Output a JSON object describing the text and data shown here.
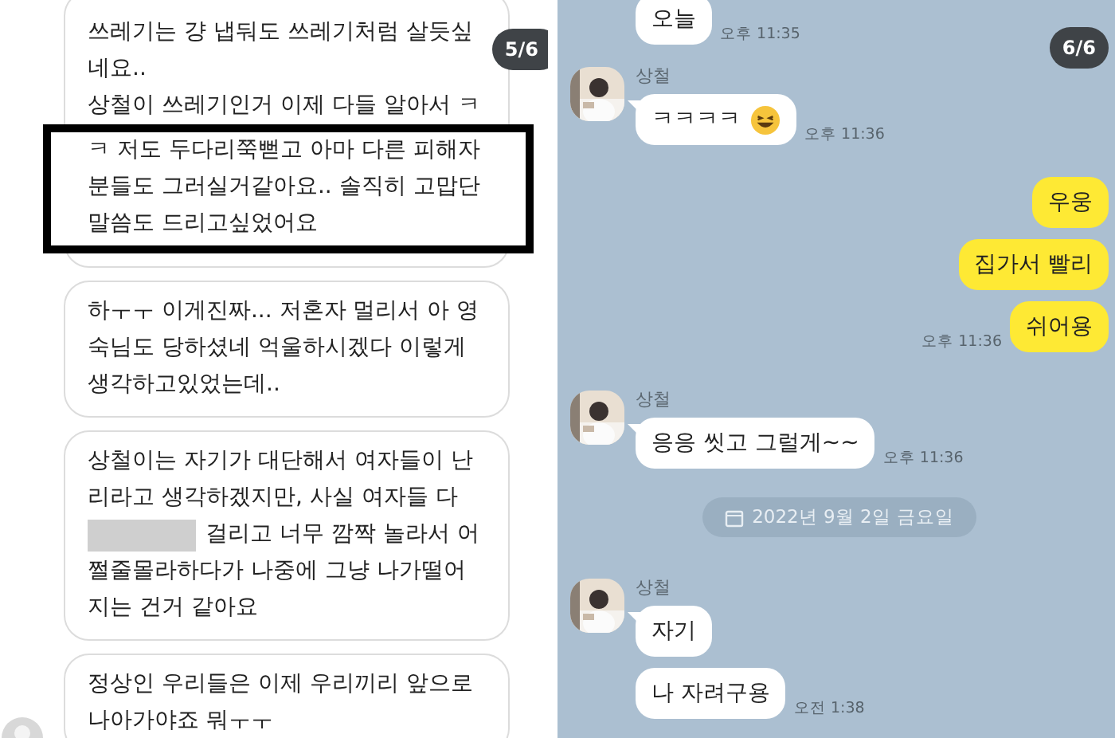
{
  "left_panel": {
    "page_badge": "5/6",
    "messages": [
      {
        "lines": [
          {
            "text": "쓰레기는 걍 냅둬도 쓰레기처럼 살듯싶",
            "highlighted": false
          },
          {
            "text": "네요..",
            "highlighted": false
          },
          {
            "text": "상철이 쓰레기인거 이제 다들 알아서 ㅋ",
            "highlighted": false
          },
          {
            "text": "ㅋ 저도 두다리쭉뻗고 아마 다른 피해자",
            "highlighted": true
          },
          {
            "text": "분들도 그러실거같아요.. 솔직히 고맙단",
            "highlighted": true
          },
          {
            "text": "말씀도 드리고싶었어요",
            "highlighted": true
          }
        ]
      },
      {
        "lines": [
          {
            "text": "하ㅜㅜ 이게진짜... 저혼자 멀리서 아 영",
            "highlighted": false
          },
          {
            "text": "숙님도 당하셨네 억울하시겠다 이렇게",
            "highlighted": false
          },
          {
            "text": "생각하고있었는데..",
            "highlighted": false
          }
        ]
      },
      {
        "lines": [
          {
            "text": "상철이는 자기가 대단해서 여자들이 난",
            "highlighted": false
          },
          {
            "text": "리라고 생각하겠지만, 사실 여자들 다",
            "highlighted": false
          },
          {
            "text": "걸리고 너무 깜짝 놀라서 어",
            "highlighted": false,
            "redacted_before": true
          },
          {
            "text": "쩔줄몰라하다가 나중에 그냥 나가떨어",
            "highlighted": false
          },
          {
            "text": "지는 건거 같아요",
            "highlighted": false
          }
        ]
      },
      {
        "lines": [
          {
            "text": "정상인 우리들은 이제 우리끼리 앞으로",
            "highlighted": false
          },
          {
            "text": "나아가야죠 뭐ㅜㅜ",
            "highlighted": false
          }
        ],
        "avatar": true
      }
    ]
  },
  "right_panel": {
    "page_badge": "6/6",
    "items": [
      {
        "kind": "incoming",
        "bubbles": [
          {
            "text": "오늘"
          }
        ],
        "time": "오후 11:35"
      },
      {
        "kind": "incoming",
        "sender": "상철",
        "bubbles": [
          {
            "text": "ㅋㅋㅋㅋ",
            "emoji": true
          }
        ],
        "time": "오후 11:36"
      },
      {
        "kind": "outgoing",
        "bubbles": [
          {
            "text": "우웅"
          },
          {
            "text": "집가서 빨리"
          },
          {
            "text": "쉬어용"
          }
        ],
        "time": "오후 11:36"
      },
      {
        "kind": "incoming",
        "sender": "상철",
        "bubbles": [
          {
            "text": "응응 씻고 그럴게~~"
          }
        ],
        "time": "오후 11:36"
      },
      {
        "kind": "date",
        "text": "2022년 9월 2일 금요일"
      },
      {
        "kind": "incoming",
        "sender": "상철",
        "bubbles": [
          {
            "text": "자기"
          },
          {
            "text": "나 자려구용"
          }
        ],
        "time": "오전 1:38"
      }
    ]
  }
}
